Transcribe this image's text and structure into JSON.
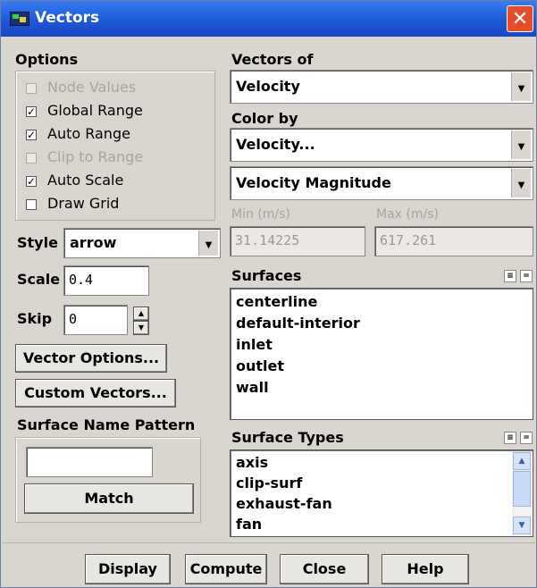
{
  "window": {
    "title": "Vectors",
    "close_glyph": "✕"
  },
  "options": {
    "heading": "Options",
    "items": [
      {
        "label": "Node Values",
        "checked": false,
        "enabled": false
      },
      {
        "label": "Global Range",
        "checked": true,
        "enabled": true
      },
      {
        "label": "Auto Range",
        "checked": true,
        "enabled": true
      },
      {
        "label": "Clip to Range",
        "checked": false,
        "enabled": false
      },
      {
        "label": "Auto Scale",
        "checked": true,
        "enabled": true
      },
      {
        "label": "Draw Grid",
        "checked": false,
        "enabled": true
      }
    ]
  },
  "style": {
    "label": "Style",
    "value": "arrow"
  },
  "scale": {
    "label": "Scale",
    "value": "0.4"
  },
  "skip": {
    "label": "Skip",
    "value": "0"
  },
  "buttons": {
    "vector_options": "Vector Options...",
    "custom_vectors": "Custom Vectors...",
    "match": "Match"
  },
  "pattern": {
    "label": "Surface Name Pattern",
    "value": ""
  },
  "vectors_of": {
    "label": "Vectors of",
    "value": "Velocity"
  },
  "color_by": {
    "label": "Color by",
    "value": "Velocity...",
    "sub_value": "Velocity Magnitude"
  },
  "range": {
    "min_label": "Min (m/s)",
    "min_value": "31.14225",
    "max_label": "Max (m/s)",
    "max_value": "617.261"
  },
  "surfaces": {
    "label": "Surfaces",
    "items": [
      "centerline",
      "default-interior",
      "inlet",
      "outlet",
      "wall"
    ]
  },
  "surface_types": {
    "label": "Surface Types",
    "items": [
      "axis",
      "clip-surf",
      "exhaust-fan",
      "fan"
    ]
  },
  "footer": {
    "display": "Display",
    "compute": "Compute",
    "close": "Close",
    "help": "Help"
  },
  "colors": {
    "title_bar": "#1c58d8",
    "close_button": "#e44c2c",
    "dialog_bg": "#d9d6cf"
  }
}
